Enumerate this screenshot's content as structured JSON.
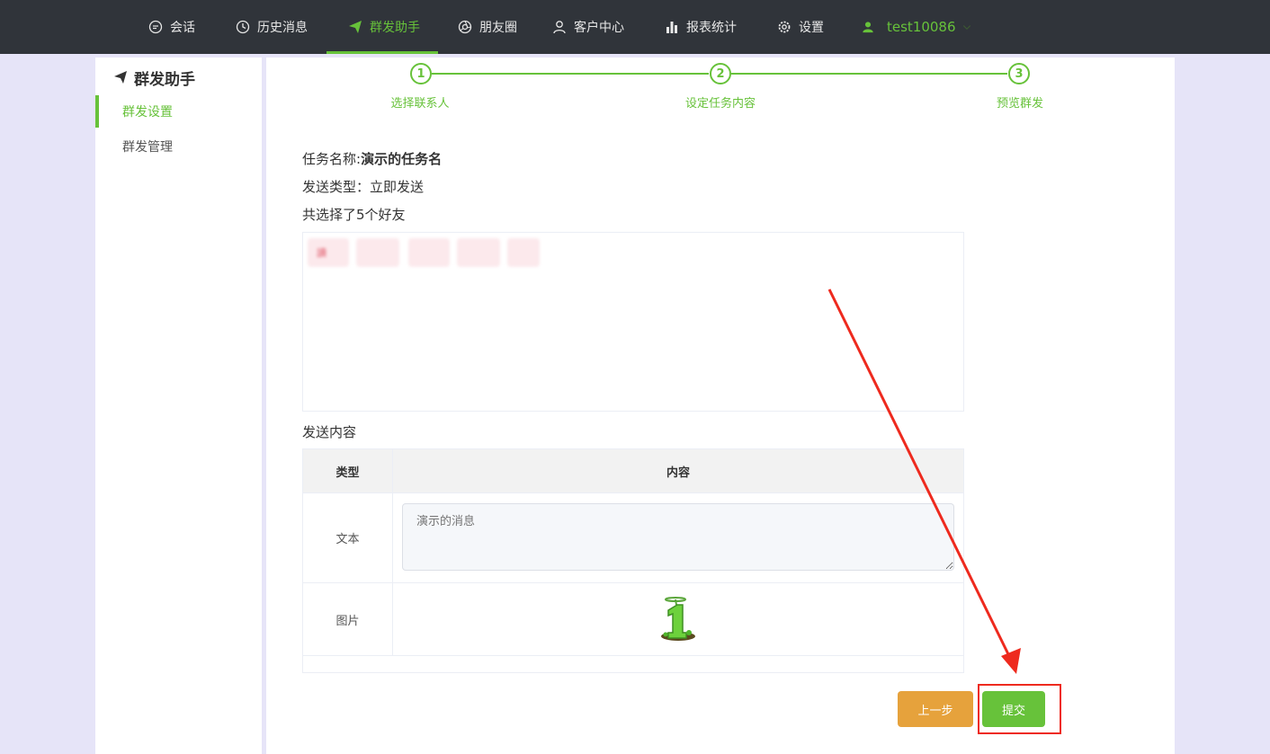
{
  "nav": {
    "items": [
      {
        "label": "会话"
      },
      {
        "label": "历史消息"
      },
      {
        "label": "群发助手"
      },
      {
        "label": "朋友圈"
      },
      {
        "label": "客户中心"
      },
      {
        "label": "报表统计"
      },
      {
        "label": "设置"
      }
    ],
    "active_index": 2,
    "user": "test10086"
  },
  "sidebar": {
    "title": "群发助手",
    "items": [
      {
        "label": "群发设置"
      },
      {
        "label": "群发管理"
      }
    ],
    "active_index": 0
  },
  "steps": [
    {
      "number": "1",
      "label": "选择联系人"
    },
    {
      "number": "2",
      "label": "设定任务内容"
    },
    {
      "number": "3",
      "label": "预览群发"
    }
  ],
  "task": {
    "name_label": "任务名称:",
    "name_value": "演示的任务名",
    "send_type": "发送类型：立即发送",
    "friends_summary": "共选择了5个好友",
    "chip_fragment": "讀"
  },
  "content": {
    "label": "发送内容",
    "col_type": "类型",
    "col_content": "内容",
    "rows": [
      {
        "type": "文本",
        "placeholder": "演示的消息"
      },
      {
        "type": "图片"
      }
    ]
  },
  "buttons": {
    "prev": "上一步",
    "submit": "提交"
  },
  "colors": {
    "accent": "#67c23a",
    "warning": "#e6a23c",
    "topbar": "#30343a",
    "annotation": "#ee2a1e"
  }
}
